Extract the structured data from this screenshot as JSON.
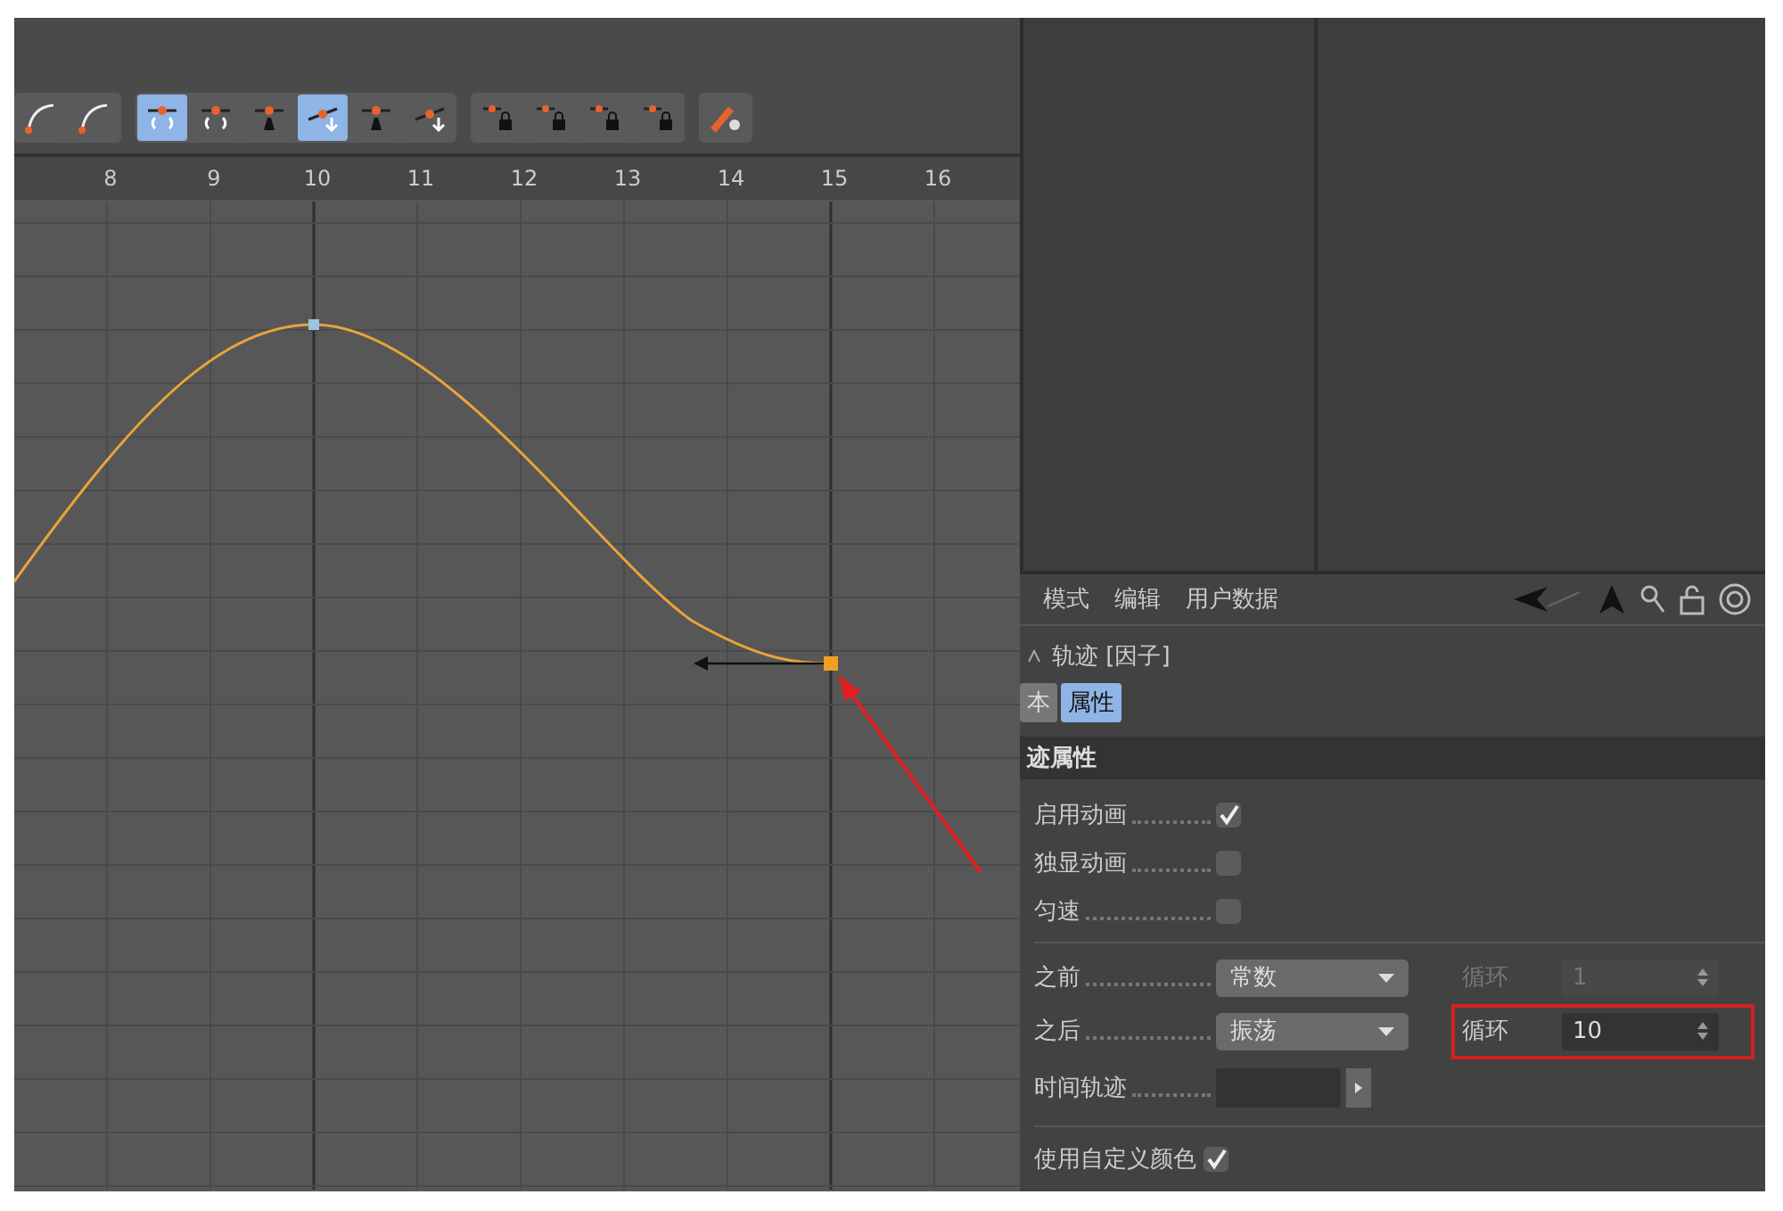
{
  "toolbar": {
    "groups": [
      {
        "buttons": [
          {
            "kind": "curve",
            "selected": false
          },
          {
            "kind": "curve",
            "selected": false
          }
        ]
      },
      {
        "buttons": [
          {
            "kind": "ease",
            "selected": true
          },
          {
            "kind": "ease",
            "selected": false
          },
          {
            "kind": "weight",
            "selected": false
          },
          {
            "kind": "tangent",
            "selected": true
          },
          {
            "kind": "weight",
            "selected": false
          },
          {
            "kind": "tangent",
            "selected": false
          }
        ]
      },
      {
        "buttons": [
          {
            "kind": "lock",
            "selected": false
          },
          {
            "kind": "lock",
            "selected": false
          },
          {
            "kind": "lock",
            "selected": false
          },
          {
            "kind": "lock",
            "selected": false
          }
        ]
      },
      {
        "buttons": [
          {
            "kind": "tool",
            "selected": false
          }
        ]
      }
    ]
  },
  "ruler": {
    "labels": [
      "8",
      "9",
      "10",
      "11",
      "12",
      "13",
      "14",
      "15",
      "16"
    ]
  },
  "attributes": {
    "menu": [
      "模式",
      "编辑",
      "用户数据"
    ],
    "title": "轨迹 [因子]",
    "tabs": [
      {
        "label": "本",
        "selected": false
      },
      {
        "label": "属性",
        "selected": true
      }
    ],
    "section": "迹属性",
    "checkboxes": [
      {
        "label": "启用动画",
        "checked": true
      },
      {
        "label": "独显动画",
        "checked": false
      },
      {
        "label": "匀速",
        "checked": false
      }
    ],
    "tracks": [
      {
        "label": "之前",
        "value": "常数",
        "loop_label": "循环",
        "loop_value": "1",
        "disabled": true,
        "highlighted": false
      },
      {
        "label": "之后",
        "value": "振荡",
        "loop_label": "循环",
        "loop_value": "10",
        "disabled": false,
        "highlighted": true
      }
    ],
    "time_track": {
      "label": "时间轨迹"
    },
    "custom_color": {
      "label": "使用自定义颜色",
      "checked": true
    }
  }
}
